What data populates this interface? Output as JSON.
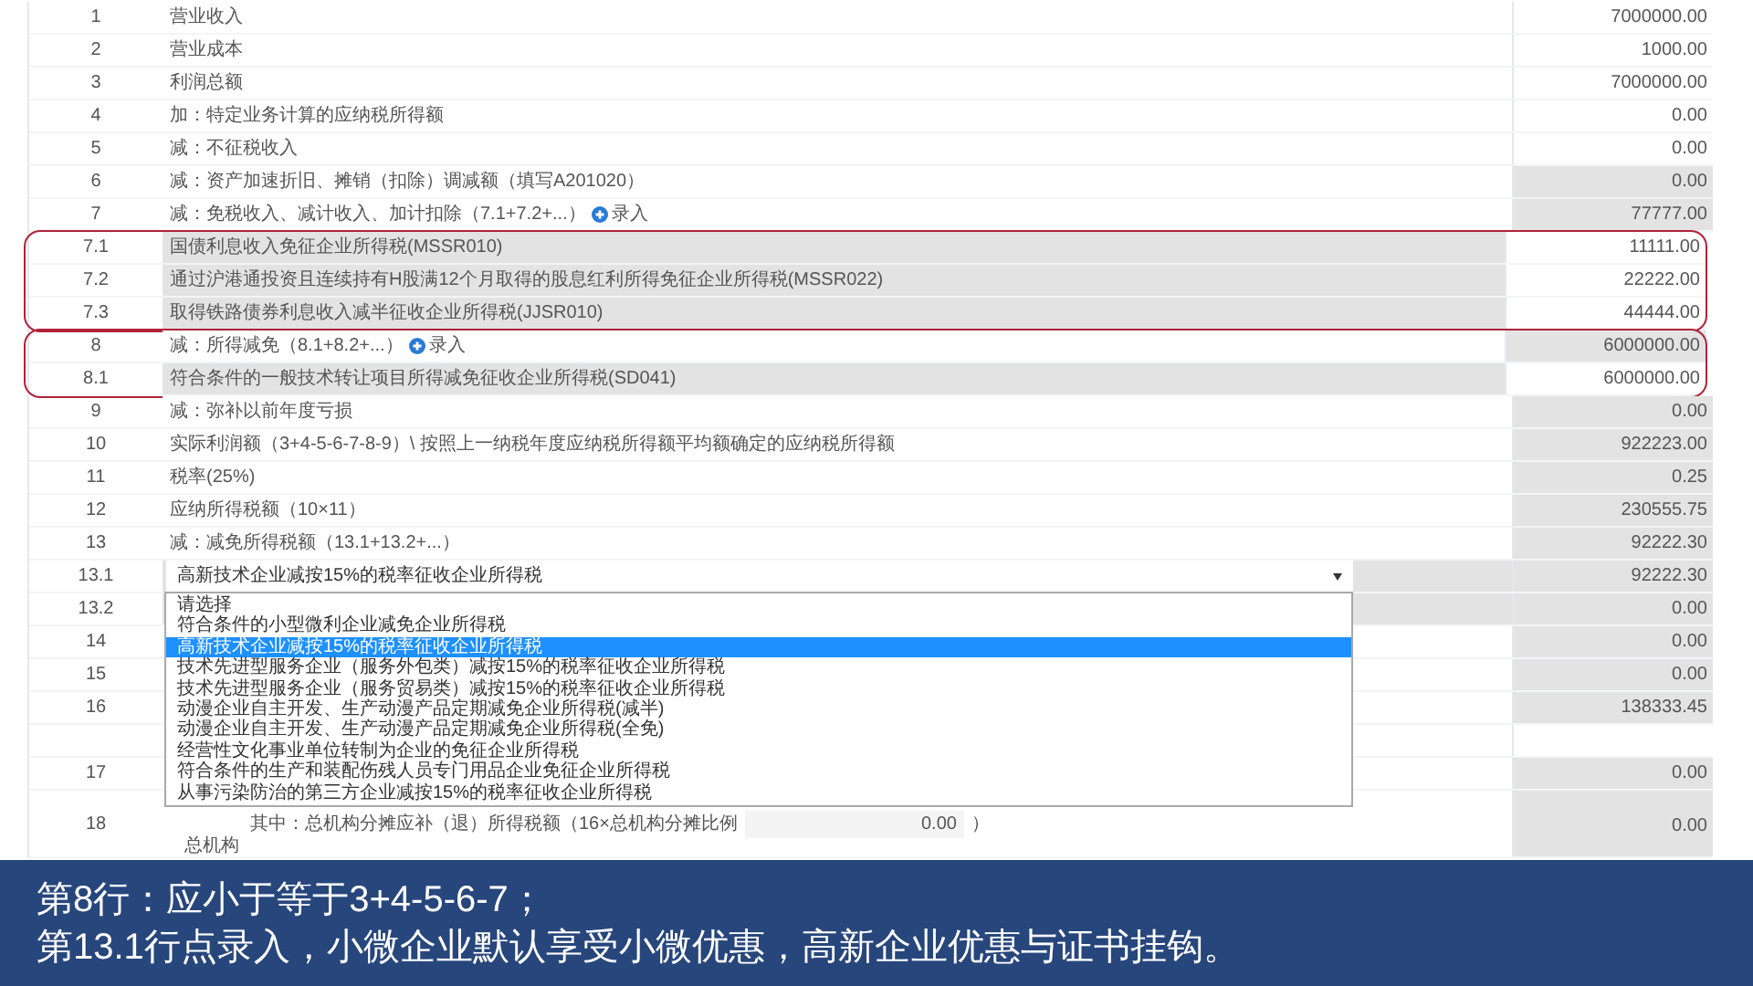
{
  "sections": [
    {
      "outlined": false,
      "rows": [
        {
          "kind": "line",
          "number": "1",
          "label": "营业收入",
          "value": "7000000.00",
          "label_shaded": false,
          "value_shaded": false
        },
        {
          "kind": "line",
          "number": "2",
          "label": "营业成本",
          "value": "1000.00",
          "label_shaded": false,
          "value_shaded": false
        },
        {
          "kind": "line",
          "number": "3",
          "label": "利润总额",
          "value": "7000000.00",
          "label_shaded": false,
          "value_shaded": false
        },
        {
          "kind": "line",
          "number": "4",
          "label": "加：特定业务计算的应纳税所得额",
          "value": "0.00",
          "label_shaded": false,
          "value_shaded": false
        },
        {
          "kind": "line",
          "number": "5",
          "label": "减：不征税收入",
          "value": "0.00",
          "label_shaded": false,
          "value_shaded": false
        },
        {
          "kind": "line",
          "number": "6",
          "label": "减：资产加速折旧、摊销（扣除）调减额（填写A201020）",
          "value": "0.00",
          "label_shaded": false,
          "value_shaded": true
        },
        {
          "kind": "line",
          "number": "7",
          "label": "减：免税收入、减计收入、加计扣除（7.1+7.2+...）",
          "link": "录入",
          "value": "77777.00",
          "label_shaded": false,
          "value_shaded": true
        }
      ]
    },
    {
      "outlined": true,
      "rows": [
        {
          "kind": "line",
          "number": "7.1",
          "label": "国债利息收入免征企业所得税(MSSR010)",
          "value": "11111.00",
          "label_shaded": true,
          "value_shaded": false
        },
        {
          "kind": "line",
          "number": "7.2",
          "label": "通过沪港通投资且连续持有H股满12个月取得的股息红利所得免征企业所得税(MSSR022)",
          "value": "22222.00",
          "label_shaded": true,
          "value_shaded": false
        },
        {
          "kind": "line",
          "number": "7.3",
          "label": "取得铁路债券利息收入减半征收企业所得税(JJSR010)",
          "value": "44444.00",
          "label_shaded": true,
          "value_shaded": false
        }
      ]
    },
    {
      "outlined": true,
      "rows": [
        {
          "kind": "line",
          "number": "8",
          "label": "减：所得减免（8.1+8.2+...）",
          "link": "录入",
          "value": "6000000.00",
          "label_shaded": false,
          "value_shaded": true
        },
        {
          "kind": "line",
          "number": "8.1",
          "label": "符合条件的一般技术转让项目所得减免征收企业所得税(SD041)",
          "value": "6000000.00",
          "label_shaded": true,
          "value_shaded": false
        }
      ]
    },
    {
      "outlined": false,
      "rows": [
        {
          "kind": "line",
          "number": "9",
          "label": "减：弥补以前年度亏损",
          "value": "0.00",
          "label_shaded": false,
          "value_shaded": true
        },
        {
          "kind": "line",
          "number": "10",
          "label": "实际利润额（3+4-5-6-7-8-9）\\ 按照上一纳税年度应纳税所得额平均额确定的应纳税所得额",
          "value": "922223.00",
          "label_shaded": false,
          "value_shaded": true
        },
        {
          "kind": "line",
          "number": "11",
          "label": "税率(25%)",
          "value": "0.25",
          "label_shaded": false,
          "value_shaded": true
        },
        {
          "kind": "line",
          "number": "12",
          "label": "应纳所得税额（10×11）",
          "value": "230555.75",
          "label_shaded": false,
          "value_shaded": true
        },
        {
          "kind": "line",
          "number": "13",
          "label": "减：减免所得税额（13.1+13.2+...）",
          "value": "92222.30",
          "label_shaded": false,
          "value_shaded": true
        },
        {
          "kind": "select",
          "number": "13.1",
          "selected_value": "高新技术企业减按15%的税率征收企业所得税",
          "value": "92222.30",
          "label_shaded": true,
          "value_shaded": true,
          "options": [
            {
              "label": "请选择",
              "selected": false
            },
            {
              "label": "符合条件的小型微利企业减免企业所得税",
              "selected": false
            },
            {
              "label": "高新技术企业减按15%的税率征收企业所得税",
              "selected": true
            },
            {
              "label": "技术先进型服务企业（服务外包类）减按15%的税率征收企业所得税",
              "selected": false
            },
            {
              "label": "技术先进型服务企业（服务贸易类）减按15%的税率征收企业所得税",
              "selected": false
            },
            {
              "label": "动漫企业自主开发、生产动漫产品定期减免企业所得税(减半)",
              "selected": false
            },
            {
              "label": "动漫企业自主开发、生产动漫产品定期减免企业所得税(全免)",
              "selected": false
            },
            {
              "label": "经营性文化事业单位转制为企业的免征企业所得税",
              "selected": false
            },
            {
              "label": "符合条件的生产和装配伤残人员专门用品企业免征企业所得税",
              "selected": false
            },
            {
              "label": "从事污染防治的第三方企业减按15%的税率征收企业所得税",
              "selected": false
            }
          ]
        },
        {
          "kind": "line",
          "number": "13.2",
          "value": "0.00",
          "label_shaded": true,
          "value_shaded": true
        },
        {
          "kind": "line",
          "number": "14",
          "value": "0.00",
          "label_shaded": false,
          "value_shaded": true
        },
        {
          "kind": "line",
          "number": "15",
          "value": "0.00",
          "label_shaded": false,
          "value_shaded": true
        },
        {
          "kind": "line",
          "number": "16",
          "value": "138333.45",
          "label_shaded": false,
          "value_shaded": true
        },
        {
          "kind": "line",
          "label_shaded": false,
          "value_shaded": false
        },
        {
          "kind": "line",
          "number": "17",
          "value": "0.00",
          "label_shaded": false,
          "value_shaded": true
        },
        {
          "kind": "share",
          "number": "18",
          "label": "其中：总机构分摊应补（退）所得税额（16×总机构分摊比例",
          "input": "0.00",
          "suffix": "）",
          "continuation": "总机构",
          "value": "0.00",
          "label_shaded": false,
          "value_shaded": true
        }
      ]
    }
  ],
  "caption": [
    "第8行：应小于等于3+4-5-6-7；",
    "第13.1行点录入，小微企业默认享受小微优惠，高新企业优惠与证书挂钩。"
  ]
}
